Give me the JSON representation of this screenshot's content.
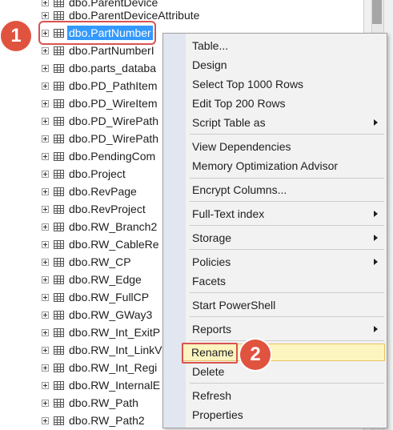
{
  "tree": {
    "rows": [
      {
        "label": "dbo.ParentDevice"
      },
      {
        "label": "dbo.ParentDeviceAttribute"
      },
      {
        "label": "dbo.PartNumber"
      },
      {
        "label": "dbo.PartNumberI"
      },
      {
        "label": "dbo.parts_databa"
      },
      {
        "label": "dbo.PD_PathItem"
      },
      {
        "label": "dbo.PD_WireItem"
      },
      {
        "label": "dbo.PD_WirePath"
      },
      {
        "label": "dbo.PD_WirePath"
      },
      {
        "label": "dbo.PendingCom"
      },
      {
        "label": "dbo.Project"
      },
      {
        "label": "dbo.RevPage"
      },
      {
        "label": "dbo.RevProject"
      },
      {
        "label": "dbo.RW_Branch2"
      },
      {
        "label": "dbo.RW_CableRe"
      },
      {
        "label": "dbo.RW_CP"
      },
      {
        "label": "dbo.RW_Edge"
      },
      {
        "label": "dbo.RW_FullCP"
      },
      {
        "label": "dbo.RW_GWay3"
      },
      {
        "label": "dbo.RW_Int_ExitP"
      },
      {
        "label": "dbo.RW_Int_LinkV"
      },
      {
        "label": "dbo.RW_Int_Regi"
      },
      {
        "label": "dbo.RW_InternalE"
      },
      {
        "label": "dbo.RW_Path"
      },
      {
        "label": "dbo.RW_Path2"
      }
    ],
    "selected_index": 2
  },
  "context_menu": {
    "items": [
      {
        "label": "Table...",
        "submenu": false
      },
      {
        "label": "Design",
        "submenu": false
      },
      {
        "label": "Select Top 1000 Rows",
        "submenu": false
      },
      {
        "label": "Edit Top 200 Rows",
        "submenu": false
      },
      {
        "label": "Script Table as",
        "submenu": true
      },
      {
        "label": "View Dependencies",
        "submenu": false
      },
      {
        "label": "Memory Optimization Advisor",
        "submenu": false
      },
      {
        "label": "Encrypt Columns...",
        "submenu": false
      },
      {
        "label": "Full-Text index",
        "submenu": true
      },
      {
        "label": "Storage",
        "submenu": true
      },
      {
        "label": "Policies",
        "submenu": true
      },
      {
        "label": "Facets",
        "submenu": false
      },
      {
        "label": "Start PowerShell",
        "submenu": false
      },
      {
        "label": "Reports",
        "submenu": true
      },
      {
        "label": "Rename",
        "submenu": false
      },
      {
        "label": "Delete",
        "submenu": false
      },
      {
        "label": "Refresh",
        "submenu": false
      },
      {
        "label": "Properties",
        "submenu": false
      }
    ],
    "hovered_index": 14
  },
  "badges": {
    "step1": "1",
    "step2": "2"
  },
  "colors": {
    "selection": "#3399ff",
    "badge": "#e0533f",
    "annotation_outline": "#d9534f",
    "menu_hover": "#fdf5c0"
  }
}
